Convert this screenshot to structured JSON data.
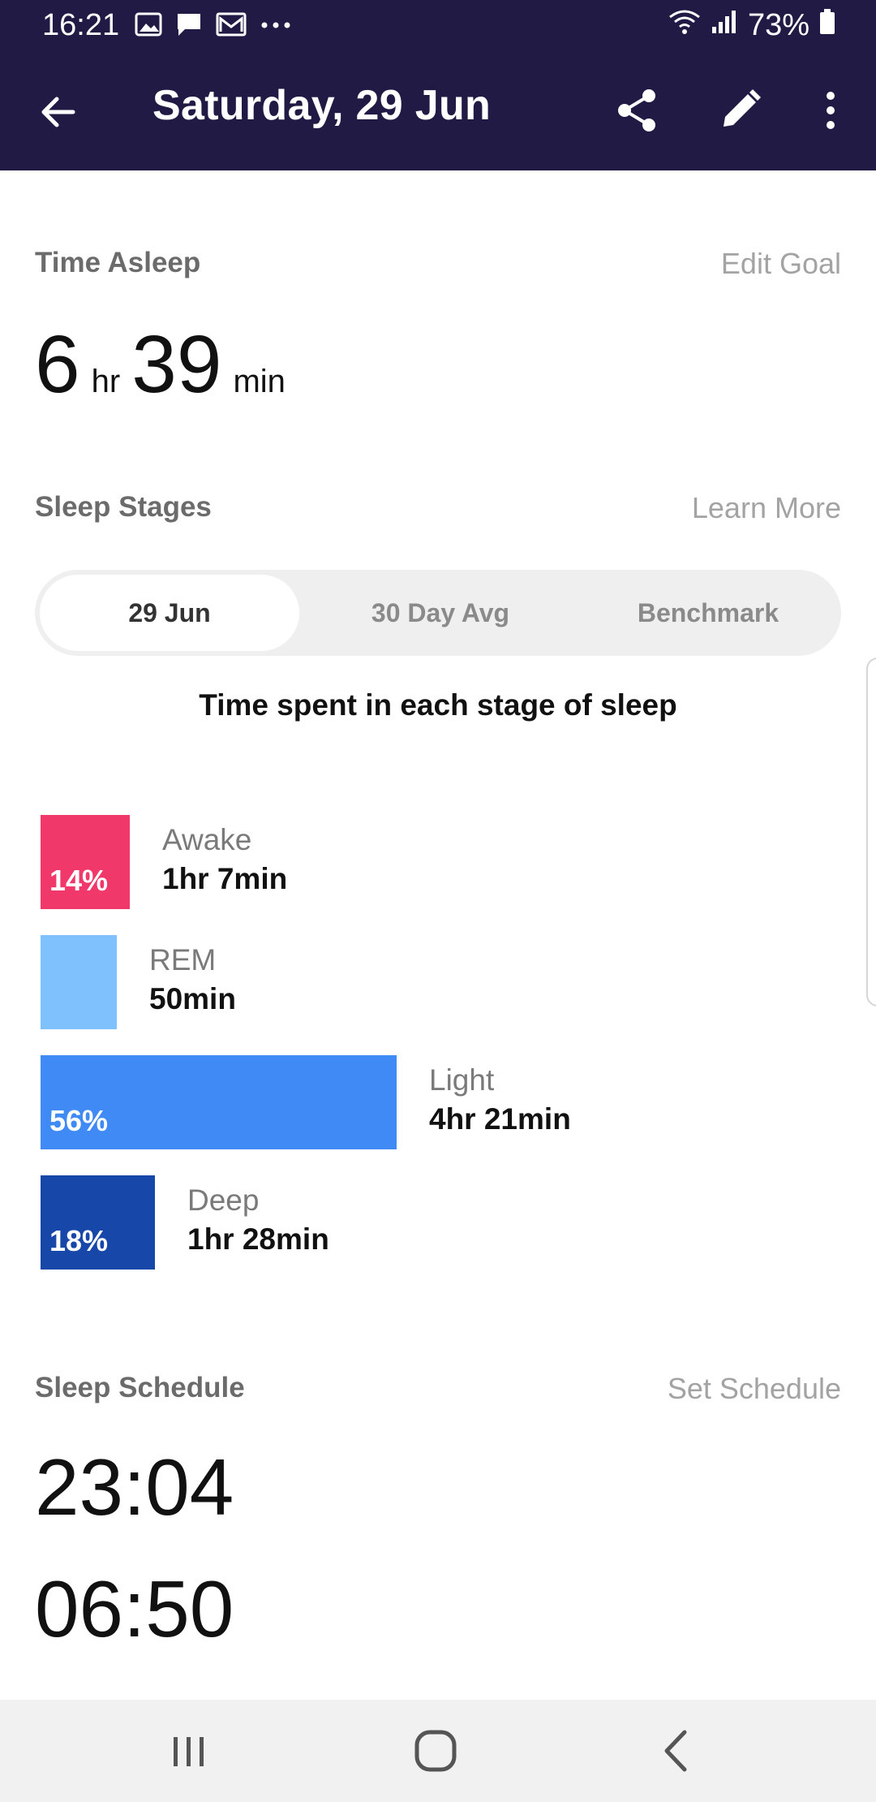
{
  "status_bar": {
    "time": "16:21",
    "icons": [
      "image-icon",
      "chat-icon",
      "gmail-icon",
      "more-dots-icon"
    ],
    "battery": "73%"
  },
  "app_bar": {
    "title": "Saturday, 29 Jun",
    "background": "#211a45"
  },
  "time_asleep": {
    "title": "Time Asleep",
    "link": "Edit Goal",
    "hours": "6",
    "hours_unit": "hr",
    "minutes": "39",
    "minutes_unit": "min"
  },
  "sleep_stages": {
    "title": "Sleep Stages",
    "link": "Learn More",
    "tabs": [
      {
        "label": "29 Jun",
        "selected": true
      },
      {
        "label": "30 Day Avg",
        "selected": false
      },
      {
        "label": "Benchmark",
        "selected": false
      }
    ],
    "caption": "Time spent in each stage of sleep",
    "stages": [
      {
        "name": "Awake",
        "percent": 14,
        "percent_label": "14%",
        "duration": "1hr 7min",
        "color": "#f0386b"
      },
      {
        "name": "REM",
        "percent": 12,
        "percent_label": "",
        "duration": "50min",
        "color": "#7ec1fc"
      },
      {
        "name": "Light",
        "percent": 56,
        "percent_label": "56%",
        "duration": "4hr 21min",
        "color": "#3f8af5"
      },
      {
        "name": "Deep",
        "percent": 18,
        "percent_label": "18%",
        "duration": "1hr 28min",
        "color": "#1747a8"
      }
    ]
  },
  "sleep_schedule": {
    "title": "Sleep Schedule",
    "link": "Set Schedule",
    "bedtime": "23:04",
    "wake": "06:50"
  },
  "nav_bar": {
    "buttons": [
      "recents-icon",
      "home-icon",
      "back-icon"
    ]
  }
}
